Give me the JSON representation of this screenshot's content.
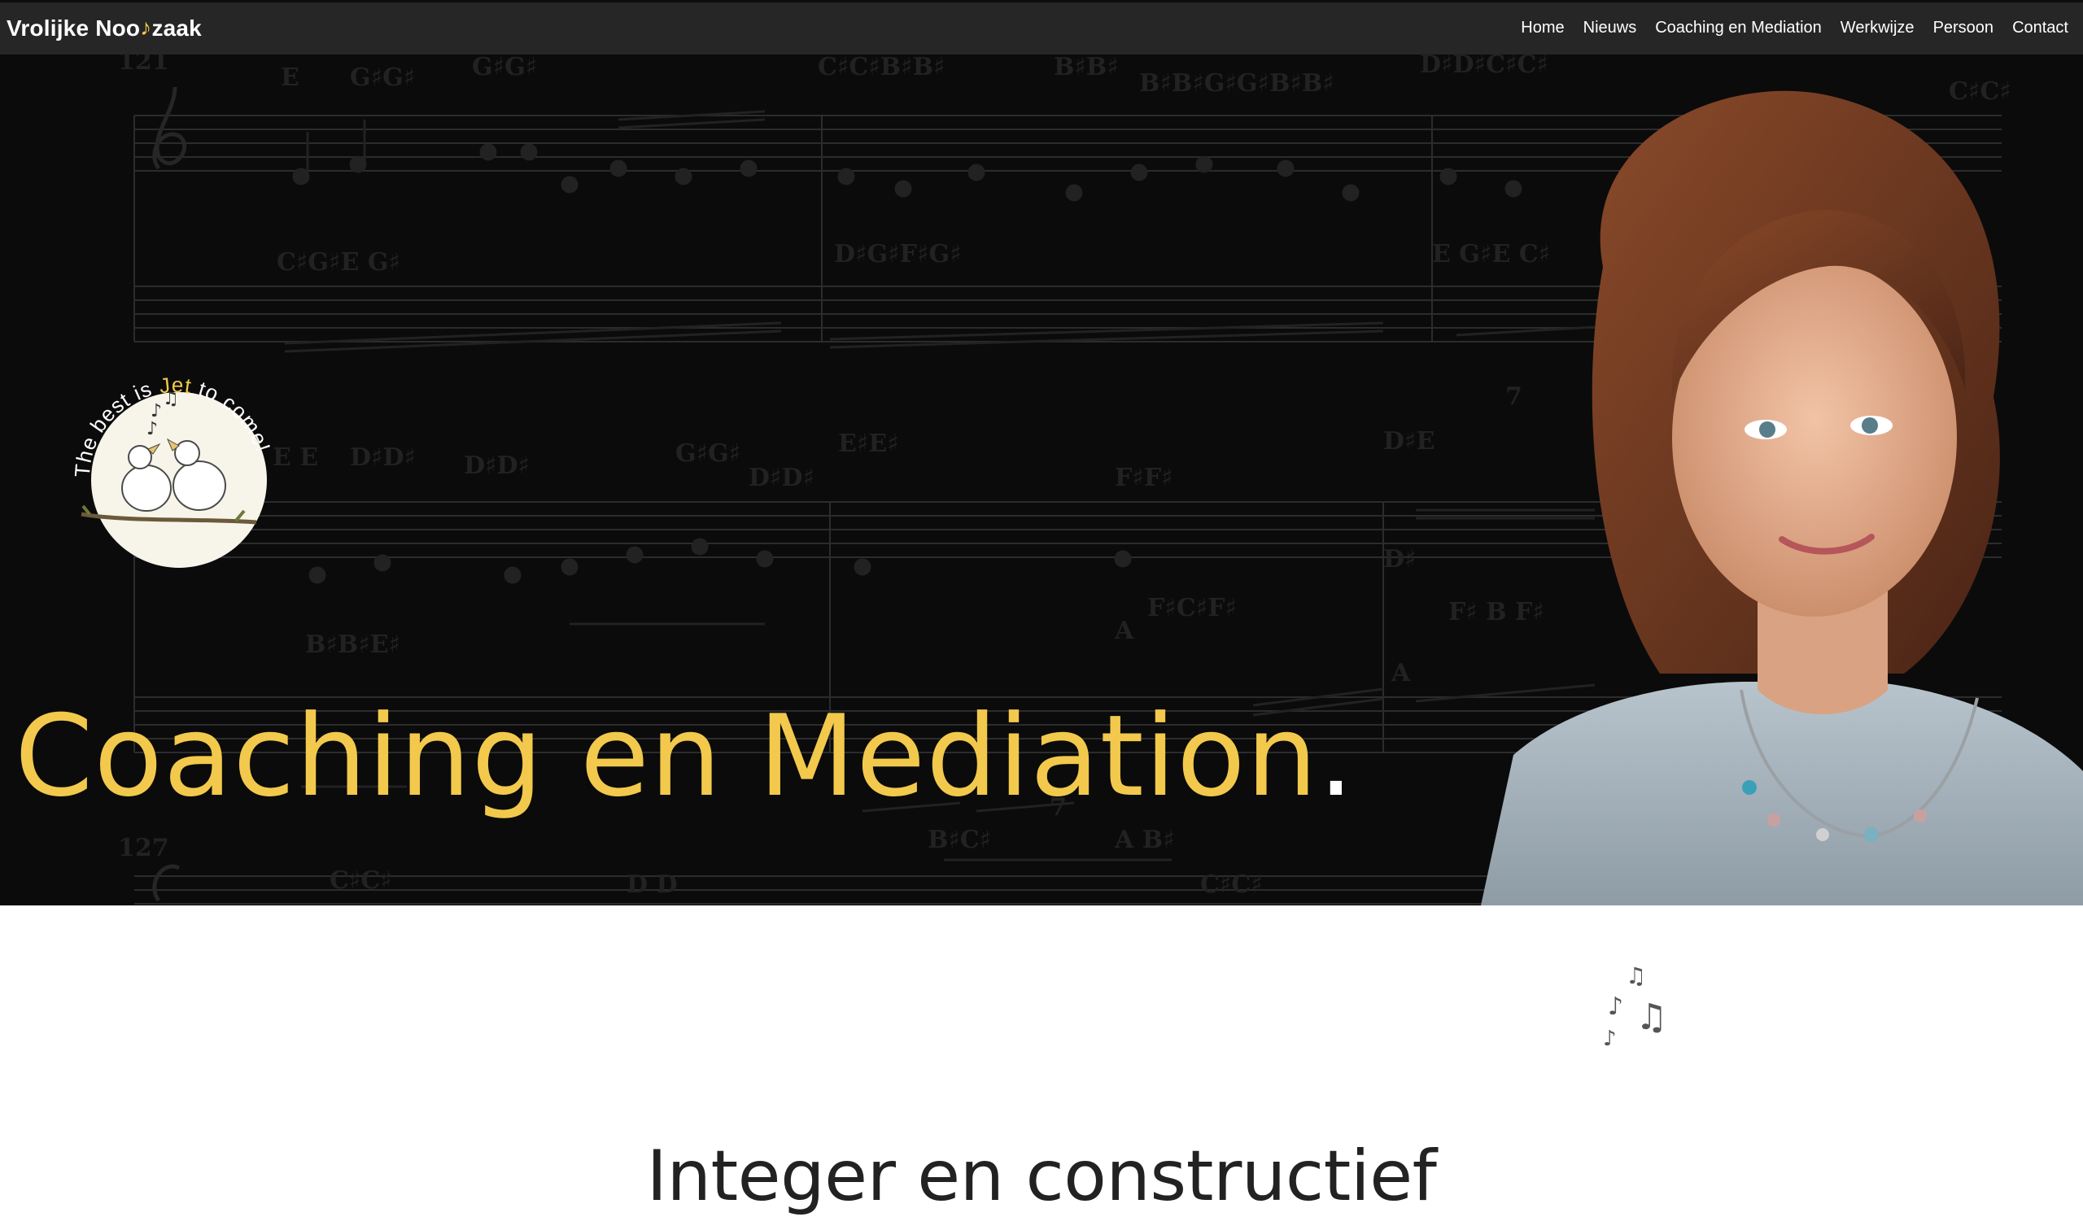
{
  "brand": {
    "name_part1": "Vrolijke Noo",
    "note_glyph": "♪",
    "name_part2": "zaak"
  },
  "nav": {
    "items": [
      {
        "label": "Home"
      },
      {
        "label": "Nieuws"
      },
      {
        "label": "Coaching en Mediation"
      },
      {
        "label": "Werkwijze"
      },
      {
        "label": "Persoon"
      },
      {
        "label": "Contact"
      }
    ]
  },
  "hero": {
    "title": "Coaching en Mediation",
    "title_dot": ".",
    "badge_text_1": "The best is ",
    "badge_text_2": "Jet",
    "badge_text_3": " to come!"
  },
  "section": {
    "title": "Integer en constructief"
  },
  "colors": {
    "accent": "#f2c94c",
    "nav_bg": "#262626",
    "hero_bg": "#0b0b0b"
  }
}
